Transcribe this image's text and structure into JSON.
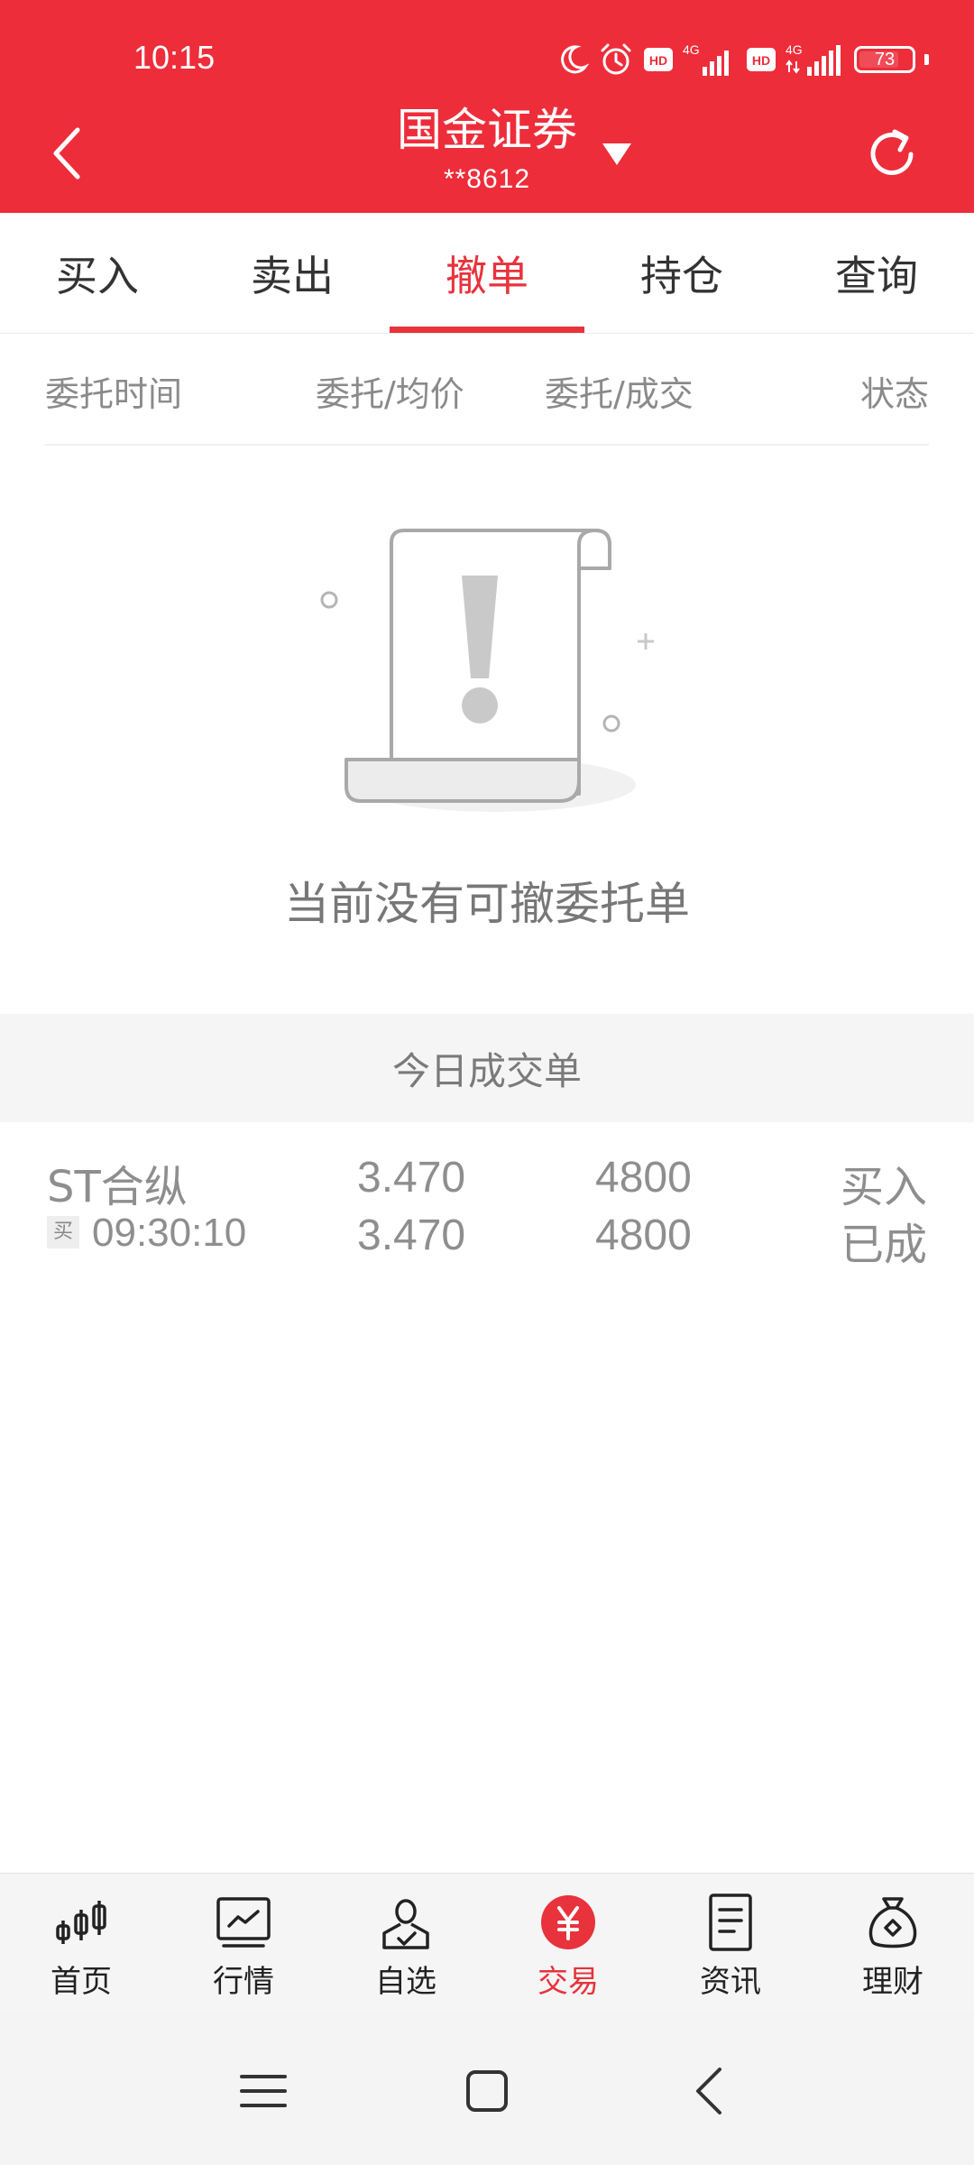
{
  "status_bar": {
    "time": "10:15",
    "network_1": "4G",
    "network_2": "4G",
    "hd_1": "HD",
    "hd_2": "HD",
    "battery": "73"
  },
  "header": {
    "title": "国金证券",
    "account": "**8612",
    "background_color": "#ee2d3a"
  },
  "tabs": [
    {
      "label": "买入",
      "active": false
    },
    {
      "label": "卖出",
      "active": false
    },
    {
      "label": "撤单",
      "active": true
    },
    {
      "label": "持仓",
      "active": false
    },
    {
      "label": "查询",
      "active": false
    }
  ],
  "columns": {
    "time": "委托时间",
    "price": "委托/均价",
    "quantity": "委托/成交",
    "status": "状态"
  },
  "empty_state": {
    "message": "当前没有可撤委托单",
    "icon": "document-exclamation-icon"
  },
  "today_trades": {
    "title": "今日成交单",
    "rows": [
      {
        "name": "ST合纵",
        "badge": "买",
        "time": "09:30:10",
        "order_price": "3.470",
        "avg_price": "3.470",
        "order_qty": "4800",
        "filled_qty": "4800",
        "side": "买入",
        "state": "已成"
      }
    ]
  },
  "bottom_nav": [
    {
      "label": "首页",
      "icon": "candlestick-icon",
      "active": false
    },
    {
      "label": "行情",
      "icon": "line-chart-icon",
      "active": false
    },
    {
      "label": "自选",
      "icon": "user-check-icon",
      "active": false
    },
    {
      "label": "交易",
      "icon": "yen-coin-icon",
      "active": true
    },
    {
      "label": "资讯",
      "icon": "news-doc-icon",
      "active": false
    },
    {
      "label": "理财",
      "icon": "money-bag-icon",
      "active": false
    }
  ],
  "accent_color": "#e8323c"
}
